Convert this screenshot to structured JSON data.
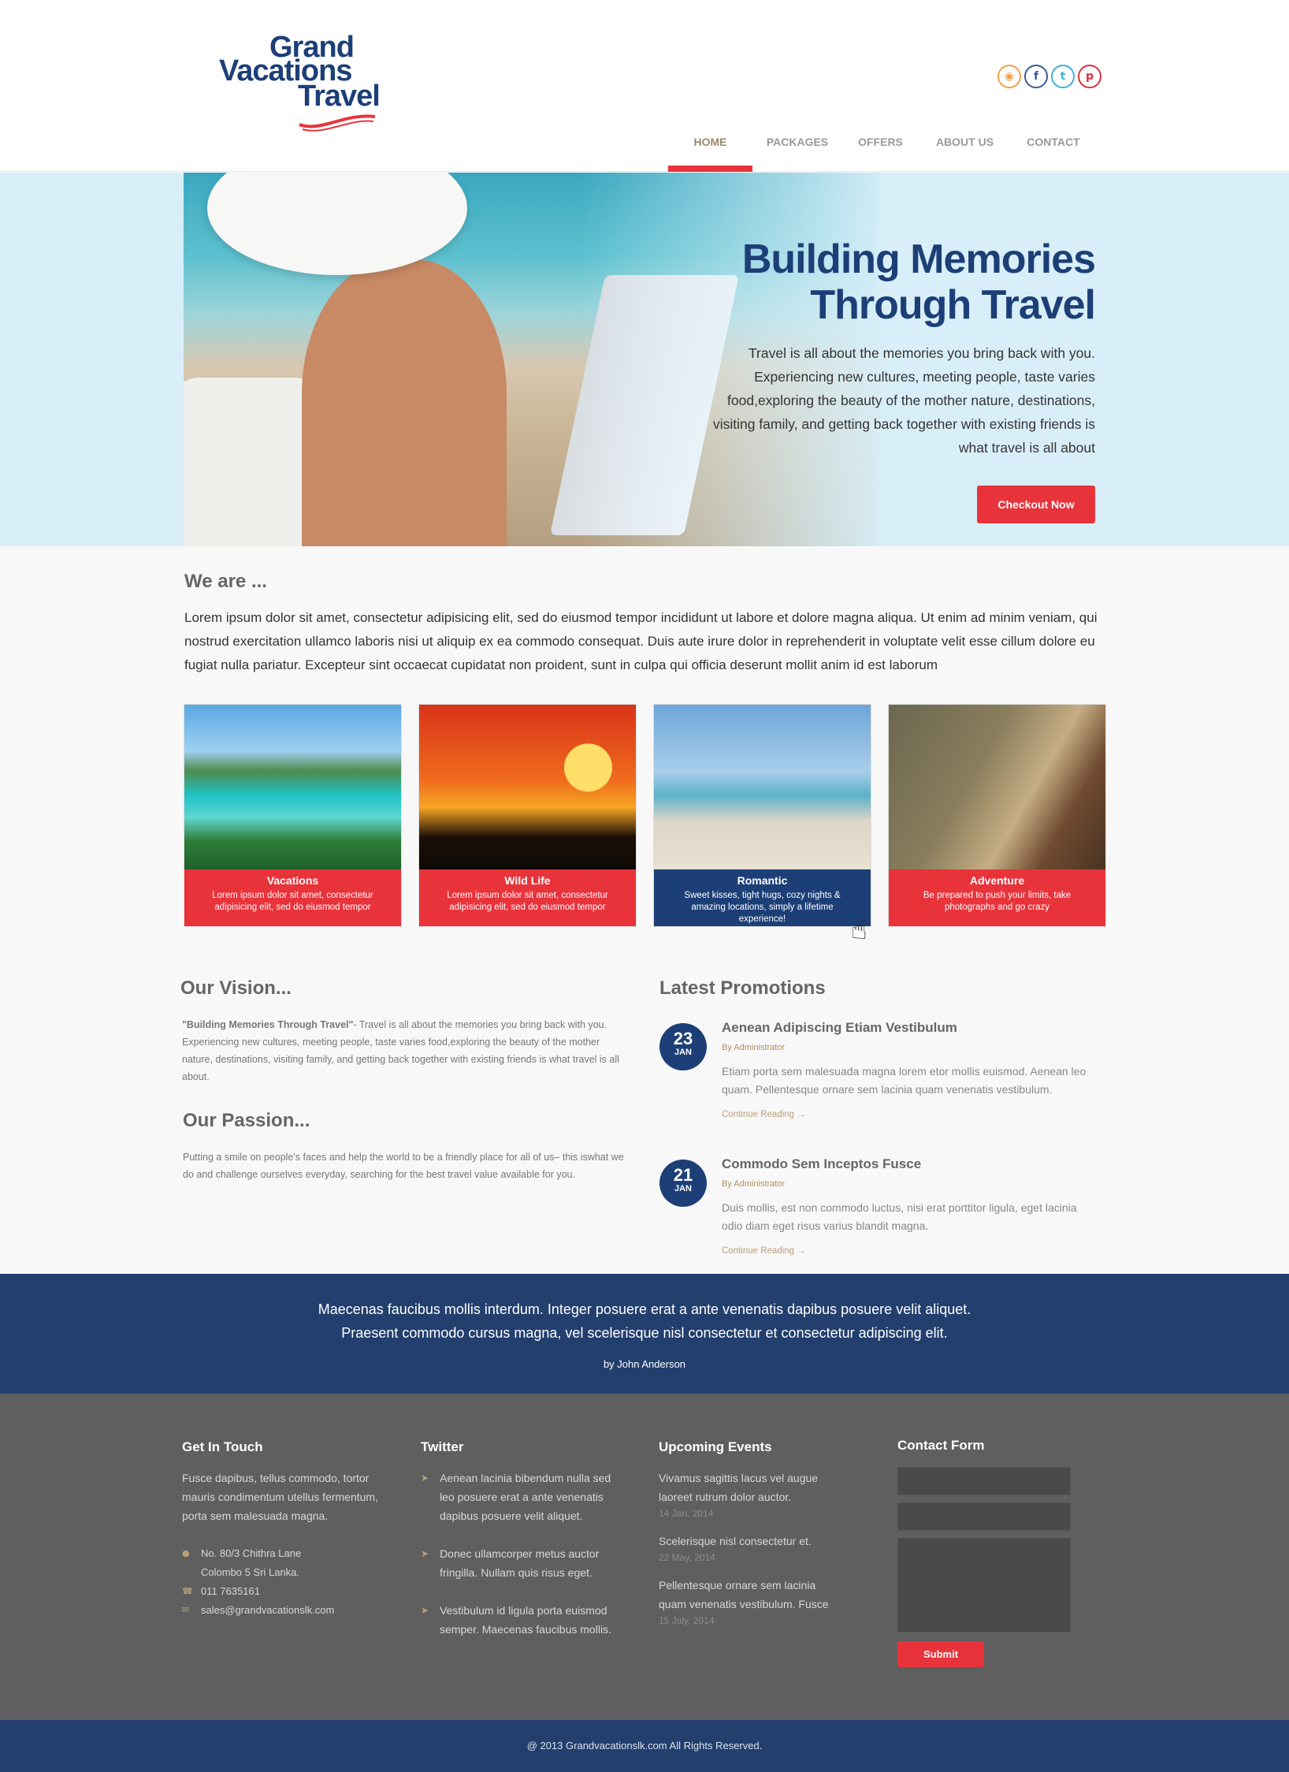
{
  "header": {
    "logo_line1": "Grand",
    "logo_line2": "Vacations",
    "logo_line3": "Travel",
    "social": [
      {
        "icon": "rss-icon",
        "glyph": "◉"
      },
      {
        "icon": "facebook-icon",
        "glyph": "f"
      },
      {
        "icon": "twitter-icon",
        "glyph": "t"
      },
      {
        "icon": "pinterest-icon",
        "glyph": "p"
      }
    ],
    "nav": [
      "HOME",
      "PACKAGES",
      "OFFERS",
      "ABOUT US",
      "CONTACT"
    ]
  },
  "hero": {
    "title_line1": "Building Memories",
    "title_line2": "Through Travel",
    "text": "Travel is all about the memories you bring back with you. Experiencing new cultures, meeting people, taste varies food,exploring the beauty of the mother nature, destinations, visiting family, and getting back together with existing friends is what travel is all about",
    "button": "Checkout Now"
  },
  "we_are": {
    "title": "We are ...",
    "text": "Lorem ipsum dolor sit amet, consectetur adipisicing elit, sed do eiusmod tempor incididunt ut labore et dolore magna aliqua. Ut enim ad minim veniam, qui nostrud exercitation ullamco laboris nisi ut aliquip ex ea commodo consequat. Duis aute irure dolor in reprehenderit in voluptate velit esse cillum dolore eu fugiat nulla pariatur. Excepteur sint occaecat cupidatat non proident, sunt in culpa qui officia deserunt mollit anim id est laborum"
  },
  "cards": [
    {
      "title": "Vacations",
      "desc": "Lorem ipsum dolor sit amet, consectetur adipisicing elit, sed do eiusmod tempor"
    },
    {
      "title": "Wild Life",
      "desc": "Lorem ipsum dolor sit amet, consectetur adipisicing elit, sed do eiusmod tempor"
    },
    {
      "title": "Romantic",
      "desc": "Sweet kisses, tight hugs, cozy nights & amazing locations, simply a lifetime experience!"
    },
    {
      "title": "Adventure",
      "desc": "Be prepared to push your limits, take photographs and go crazy"
    }
  ],
  "vision": {
    "title": "Our Vision...",
    "bold": "\"Building Memories Through Travel\"",
    "text": "- Travel is all about the memories you bring back with you. Experiencing new cultures, meeting people, taste varies food,exploring the beauty of the mother nature, destinations, visiting family, and getting back together with existing friends is what travel is all about."
  },
  "passion": {
    "title": "Our Passion...",
    "text": "Putting a smile on people's faces and help the world to be a friendly place for all of us– this iswhat we do and challenge ourselves everyday, searching for the best travel value available for you."
  },
  "promotions": {
    "title": "Latest Promotions",
    "items": [
      {
        "day": "23",
        "month": "JAN",
        "title": "Aenean Adipiscing Etiam Vestibulum",
        "by": "By Administrator",
        "text": "Etiam porta sem malesuada magna lorem etor mollis euismod. Aenean leo quam. Pellentesque ornare sem lacinia quam venenatis vestibulum.",
        "more": "Continue Reading →"
      },
      {
        "day": "21",
        "month": "JAN",
        "title": "Commodo Sem Inceptos Fusce",
        "by": "By Administrator",
        "text": "Duis mollis, est non commodo luctus, nisi erat porttitor ligula, eget lacinia odio diam eget risus varius blandit magna.",
        "more": "Continue Reading →"
      }
    ]
  },
  "quote": {
    "text": "Maecenas faucibus mollis interdum. Integer posuere erat a ante venenatis dapibus posuere velit aliquet. Praesent commodo cursus magna, vel scelerisque nisl consectetur et consectetur adipiscing elit.",
    "by": "by John Anderson"
  },
  "footer": {
    "get_in_touch": {
      "title": "Get In Touch",
      "text": "Fusce dapibus, tellus commodo, tortor mauris condimentum utellus fermentum, porta sem malesuada magna.",
      "address1": "No. 80/3 Chithra Lane",
      "address2": "Colombo 5 Sri Lanka.",
      "phone": "011 7635161",
      "email": "sales@grandvacationslk.com"
    },
    "twitter": {
      "title": "Twitter",
      "tweets": [
        "Aenean lacinia bibendum nulla sed leo posuere erat a ante venenatis dapibus posuere velit aliquet.",
        "Donec ullamcorper metus auctor fringilla. Nullam quis risus eget.",
        "Vestibulum id ligula porta  euismod semper. Maecenas faucibus mollis."
      ]
    },
    "events": {
      "title": "Upcoming Events",
      "items": [
        {
          "text": "Vivamus sagittis lacus vel augue laoreet rutrum dolor auctor.",
          "date": "14 Jan, 2014"
        },
        {
          "text": "Scelerisque nisl consectetur et.",
          "date": "22 May, 2014"
        },
        {
          "text": "Pellentesque ornare sem lacinia quam venenatis vestibulum. Fusce",
          "date": "15 July, 2014"
        }
      ]
    },
    "contact_form": {
      "title": "Contact Form",
      "submit": "Submit"
    },
    "copyright": "@ 2013 Grandvacationslk.com  All Rights Reserved."
  },
  "colors": {
    "brand_blue": "#1d3f77",
    "accent_red": "#e8333b",
    "footer_gray": "#5f5f5f"
  }
}
